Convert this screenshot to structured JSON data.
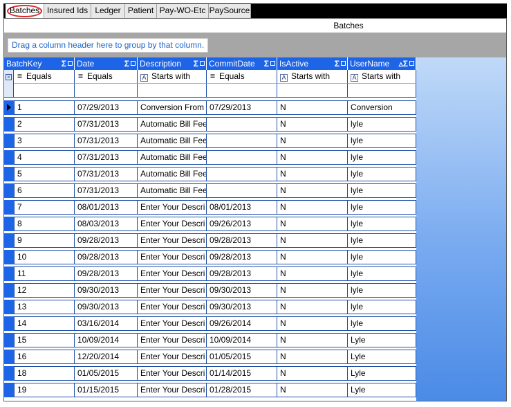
{
  "tabs": [
    {
      "label": "Batches",
      "active": true
    },
    {
      "label": "Insured Ids",
      "active": false
    },
    {
      "label": "Ledger",
      "active": false
    },
    {
      "label": "Patient",
      "active": false
    },
    {
      "label": "Pay-WO-Etc",
      "active": false
    },
    {
      "label": "PaySource",
      "active": false
    }
  ],
  "panel": {
    "caption": "Batches",
    "group_hint": "Drag a column header here to group by that column."
  },
  "grid": {
    "columns": [
      {
        "label": "BatchKey",
        "filter_op": "=",
        "filter_text": "Equals",
        "icons": "Σ⊣"
      },
      {
        "label": "Date",
        "filter_op": "=",
        "filter_text": "Equals",
        "icons": "Σ⊣"
      },
      {
        "label": "Description",
        "filter_op": "A",
        "filter_text": "Starts with",
        "icons": "Σ⊣"
      },
      {
        "label": "CommitDate",
        "filter_op": "=",
        "filter_text": "Equals",
        "icons": "Σ⊣"
      },
      {
        "label": "IsActive",
        "filter_op": "A",
        "filter_text": "Starts with",
        "icons": "Σ⊣"
      },
      {
        "label": "UserName",
        "filter_op": "A",
        "filter_text": "Starts with",
        "icons": "▵Σ⊣"
      }
    ],
    "rows": [
      [
        "1",
        "07/29/2013",
        "Conversion From",
        "07/29/2013",
        "N",
        "Conversion"
      ],
      [
        "2",
        "07/31/2013",
        "Automatic Bill Fee",
        "",
        "N",
        "lyle"
      ],
      [
        "3",
        "07/31/2013",
        "Automatic Bill Fee",
        "",
        "N",
        "lyle"
      ],
      [
        "4",
        "07/31/2013",
        "Automatic Bill Fee",
        "",
        "N",
        "lyle"
      ],
      [
        "5",
        "07/31/2013",
        "Automatic Bill Fee",
        "",
        "N",
        "lyle"
      ],
      [
        "6",
        "07/31/2013",
        "Automatic Bill Fee",
        "",
        "N",
        "lyle"
      ],
      [
        "7",
        "08/01/2013",
        "Enter Your Descri",
        "08/01/2013",
        "N",
        "lyle"
      ],
      [
        "8",
        "08/03/2013",
        "Enter Your Descri",
        "09/26/2013",
        "N",
        "lyle"
      ],
      [
        "9",
        "09/28/2013",
        "Enter Your Descri",
        "09/28/2013",
        "N",
        "lyle"
      ],
      [
        "10",
        "09/28/2013",
        "Enter Your Descri",
        "09/28/2013",
        "N",
        "lyle"
      ],
      [
        "11",
        "09/28/2013",
        "Enter Your Descri",
        "09/28/2013",
        "N",
        "lyle"
      ],
      [
        "12",
        "09/30/2013",
        "Enter Your Descri",
        "09/30/2013",
        "N",
        "lyle"
      ],
      [
        "13",
        "09/30/2013",
        "Enter Your Descri",
        "09/30/2013",
        "N",
        "lyle"
      ],
      [
        "14",
        "03/16/2014",
        "Enter Your Descri",
        "09/26/2014",
        "N",
        "lyle"
      ],
      [
        "15",
        "10/09/2014",
        "Enter Your Descri",
        "10/09/2014",
        "N",
        "Lyle"
      ],
      [
        "16",
        "12/20/2014",
        "Enter Your Descri",
        "01/05/2015",
        "N",
        "Lyle"
      ],
      [
        "18",
        "01/05/2015",
        "Enter Your Descri",
        "01/14/2015",
        "N",
        "Lyle"
      ],
      [
        "19",
        "01/15/2015",
        "Enter Your Descri",
        "01/28/2015",
        "N",
        "Lyle"
      ]
    ]
  },
  "colors": {
    "header_blue": "#1e64e6",
    "hint_text": "#1b64c8",
    "highlight_oval": "#e02828"
  }
}
